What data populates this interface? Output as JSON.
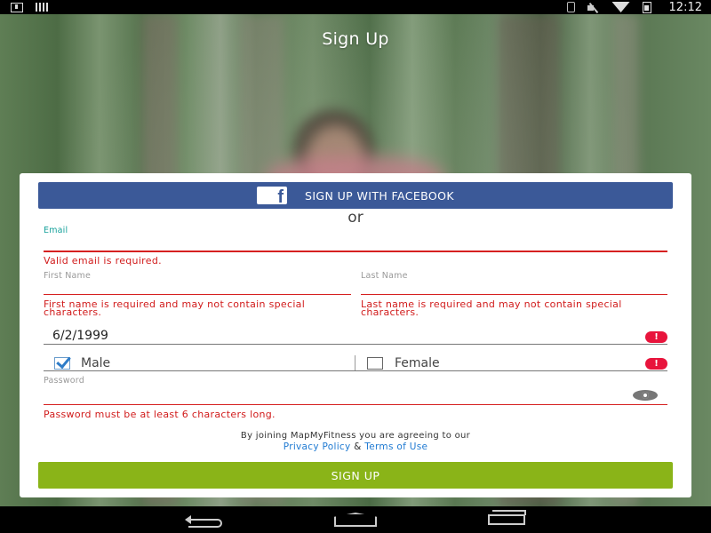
{
  "status_bar": {
    "time": "12:12",
    "icons": [
      "download-icon",
      "signal-bars-icon",
      "bluetooth-icon",
      "mute-icon",
      "wifi-icon",
      "battery-icon"
    ]
  },
  "header": {
    "title": "Sign Up"
  },
  "facebook_button": {
    "label": "SIGN UP WITH FACEBOOK",
    "logo": "f",
    "color": "#3b5998"
  },
  "divider_text": "or",
  "form": {
    "email": {
      "label": "Email",
      "value": "",
      "error": "Valid email is required."
    },
    "first_name": {
      "label": "First Name",
      "value": "",
      "error": "First name is required and may not contain special characters."
    },
    "last_name": {
      "label": "Last Name",
      "value": "",
      "error": "Last name is required and may not contain special characters."
    },
    "birthdate": {
      "value": "6/2/1999",
      "alert": "!"
    },
    "gender": {
      "options": [
        {
          "label": "Male",
          "checked": true
        },
        {
          "label": "Female",
          "checked": false
        }
      ],
      "alert": "!"
    },
    "password": {
      "label": "Password",
      "value": "",
      "error": "Password must be at least 6 characters long."
    }
  },
  "terms": {
    "line1": "By joining MapMyFitness you are agreeing to our",
    "privacy_link": "Privacy Policy",
    "separator": "&",
    "terms_link": "Terms of Use"
  },
  "signup_button": {
    "label": "SIGN UP",
    "color": "#8ab418"
  },
  "colors": {
    "error": "#d11b1b",
    "active_label": "#14a09a",
    "link": "#1f7ad2",
    "alert": "#e8143c"
  },
  "nav_bar": {
    "buttons": [
      "back-icon",
      "home-icon",
      "recents-icon"
    ]
  }
}
